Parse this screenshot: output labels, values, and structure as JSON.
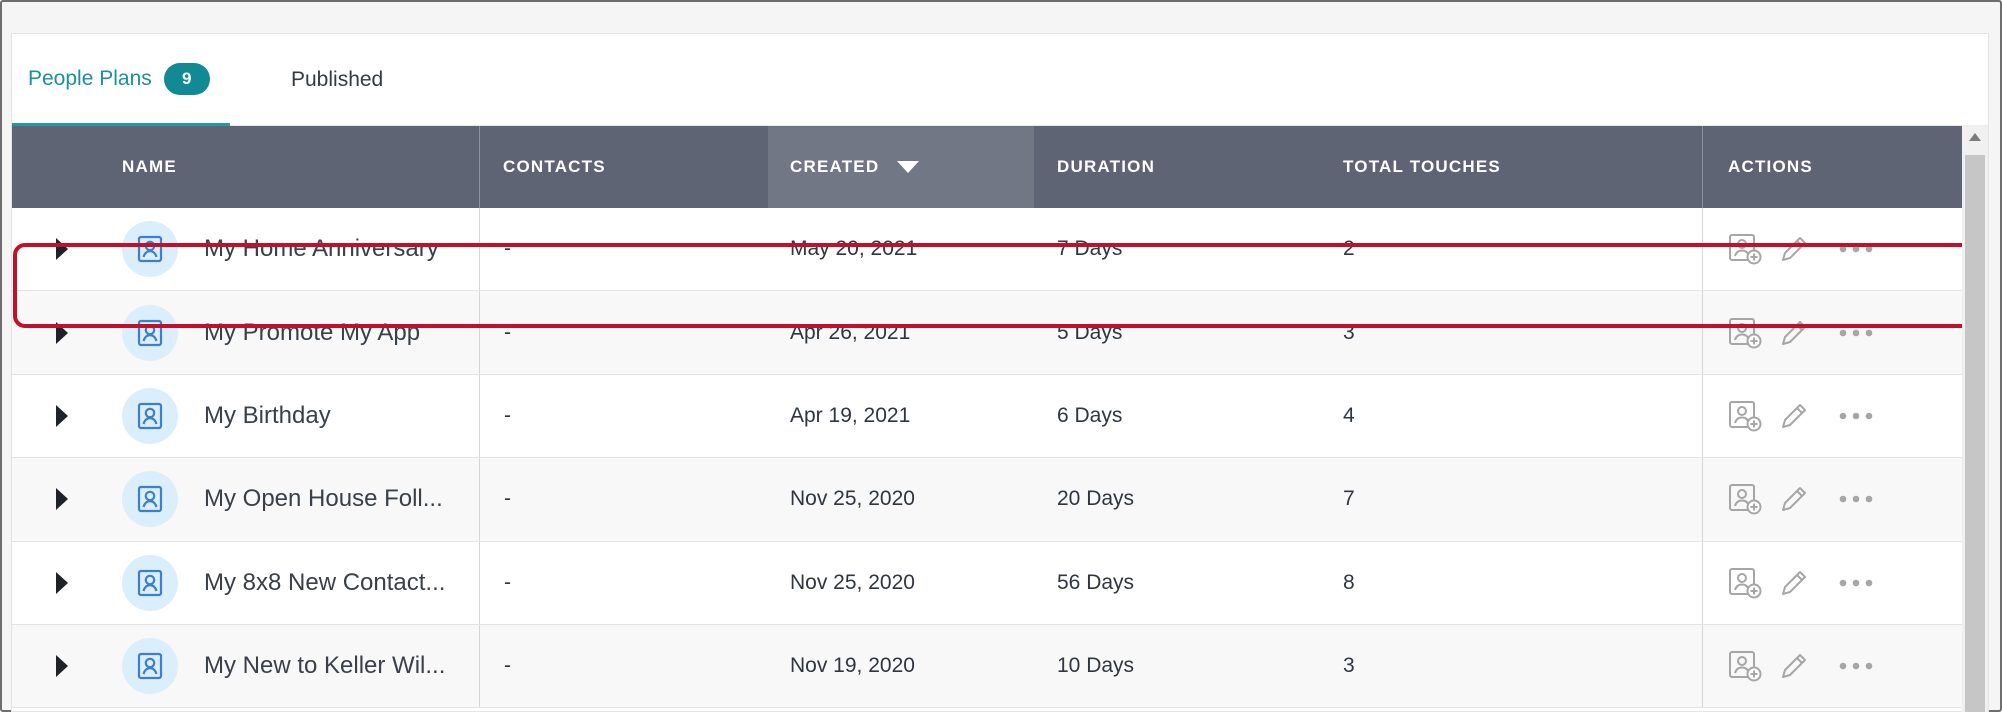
{
  "tabs": {
    "active": {
      "label": "People Plans",
      "count": "9"
    },
    "inactive": {
      "label": "Published"
    }
  },
  "columns": {
    "name": "NAME",
    "contacts": "CONTACTS",
    "created": "CREATED",
    "duration": "DURATION",
    "total_touches": "TOTAL TOUCHES",
    "actions": "ACTIONS"
  },
  "sort": {
    "column": "created",
    "direction": "descending"
  },
  "rows": [
    {
      "name": "My Home Anniversary",
      "contacts": "-",
      "created": "May 20, 2021",
      "duration": "7 Days",
      "touches": "2",
      "highlighted": true
    },
    {
      "name": "My Promote My App",
      "contacts": "-",
      "created": "Apr 26, 2021",
      "duration": "5 Days",
      "touches": "3"
    },
    {
      "name": "My Birthday",
      "contacts": "-",
      "created": "Apr 19, 2021",
      "duration": "6 Days",
      "touches": "4"
    },
    {
      "name": "My Open House Foll...",
      "contacts": "-",
      "created": "Nov 25, 2020",
      "duration": "20 Days",
      "touches": "7"
    },
    {
      "name": "My 8x8 New Contact...",
      "contacts": "-",
      "created": "Nov 25, 2020",
      "duration": "56 Days",
      "touches": "8"
    },
    {
      "name": "My New to Keller Wil...",
      "contacts": "-",
      "created": "Nov 19, 2020",
      "duration": "10 Days",
      "touches": "3"
    }
  ],
  "icons": {
    "expand": "caret-right-icon",
    "plan": "contact-card-icon",
    "add_contact": "add-contact-icon",
    "edit": "pencil-icon",
    "more": "more-horizontal-icon"
  },
  "colors": {
    "accent": "#1f8f9b",
    "header_bg": "#5f6475",
    "highlight": "#c0102a"
  }
}
